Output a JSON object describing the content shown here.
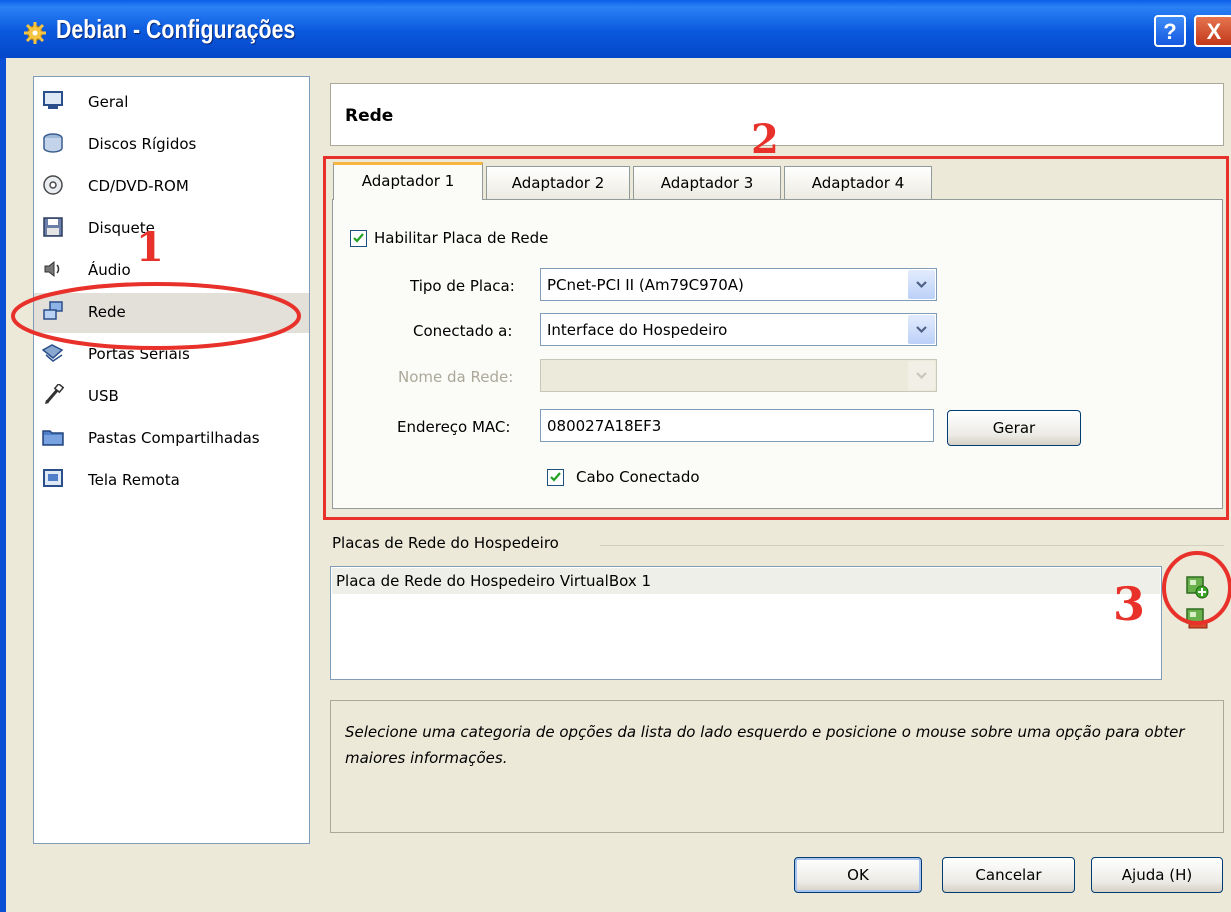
{
  "window": {
    "title": "Debian - Configurações",
    "help_label": "?",
    "close_label": "X"
  },
  "sidebar": {
    "items": [
      {
        "label": "Geral",
        "icon": "monitor-icon"
      },
      {
        "label": "Discos Rígidos",
        "icon": "hard-disk-icon"
      },
      {
        "label": "CD/DVD-ROM",
        "icon": "cd-icon"
      },
      {
        "label": "Disquete",
        "icon": "floppy-icon"
      },
      {
        "label": "Áudio",
        "icon": "speaker-icon"
      },
      {
        "label": "Rede",
        "icon": "network-icon",
        "selected": true
      },
      {
        "label": "Portas Seriais",
        "icon": "serial-port-icon"
      },
      {
        "label": "USB",
        "icon": "usb-icon"
      },
      {
        "label": "Pastas Compartilhadas",
        "icon": "folder-icon"
      },
      {
        "label": "Tela Remota",
        "icon": "remote-display-icon"
      }
    ]
  },
  "header": {
    "title": "Rede"
  },
  "tabs": [
    {
      "label": "Adaptador 1",
      "active": true
    },
    {
      "label": "Adaptador 2"
    },
    {
      "label": "Adaptador 3"
    },
    {
      "label": "Adaptador 4"
    }
  ],
  "adapter": {
    "enable_label": "Habilitar Placa de Rede",
    "enabled": true,
    "type_label": "Tipo de Placa:",
    "type_value": "PCnet-PCI II (Am79C970A)",
    "attached_label": "Conectado a:",
    "attached_value": "Interface do Hospedeiro",
    "network_name_label": "Nome da Rede:",
    "network_name_value": "",
    "mac_label": "Endereço MAC:",
    "mac_value": "080027A18EF3",
    "generate_label": "Gerar",
    "cable_label": "Cabo Conectado",
    "cable_connected": true
  },
  "host_interfaces": {
    "group_label": "Placas de Rede do Hospedeiro",
    "items": [
      "Placa de Rede do Hospedeiro VirtualBox 1"
    ]
  },
  "info_text": "Selecione uma categoria de opções da lista do lado esquerdo e posicione o mouse sobre uma opção para obter maiores informações.",
  "buttons": {
    "ok": "OK",
    "cancel": "Cancelar",
    "help": "Ajuda (H)"
  },
  "annotations": {
    "one": "1",
    "two": "2",
    "three": "3"
  },
  "colors": {
    "annotation": "#e8312a",
    "titlebar": "#0a58dd",
    "tab_active_accent": "#f8b540"
  }
}
